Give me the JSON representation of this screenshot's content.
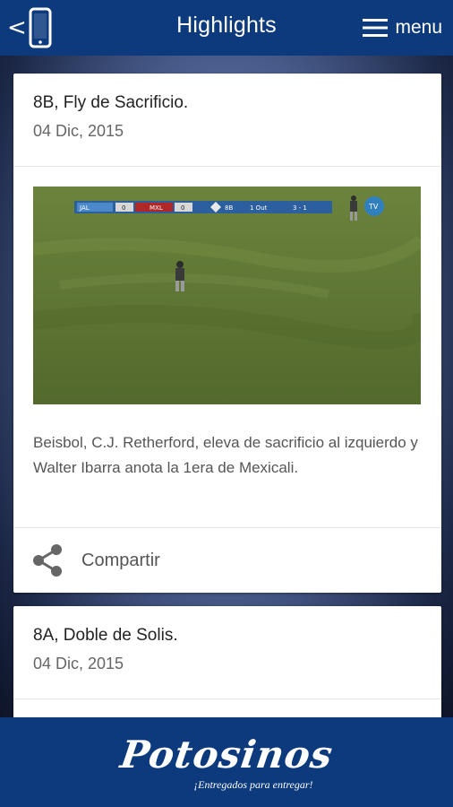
{
  "header": {
    "title": "Highlights",
    "menu_label": "menu",
    "back_icon": "chevron-left-icon",
    "device_icon": "phone-icon",
    "menu_icon": "hamburger-icon"
  },
  "colors": {
    "header_bg": "#0c3a7d",
    "card_bg": "#ffffff",
    "field_green": "#5d7634"
  },
  "cards": [
    {
      "title": "8B, Fly de Sacrificio.",
      "date": "04 Dic, 2015",
      "description": "Beisbol, C.J. Retherford, eleva de sacrificio al izquierdo y Walter Ibarra anota la 1era de Mexicali.",
      "share_label": "Compartir",
      "scoreboard": {
        "team_away": "JAL",
        "score_away": "0",
        "team_home": "MXL",
        "score_home": "0",
        "inning": "8B",
        "outs": "1 Out",
        "count": "3 - 1"
      }
    },
    {
      "title": "8A, Doble de Solis.",
      "date": "04 Dic, 2015"
    }
  ],
  "footer": {
    "logo": "Potosinos",
    "tagline": "¡Entregados para entregar!"
  }
}
